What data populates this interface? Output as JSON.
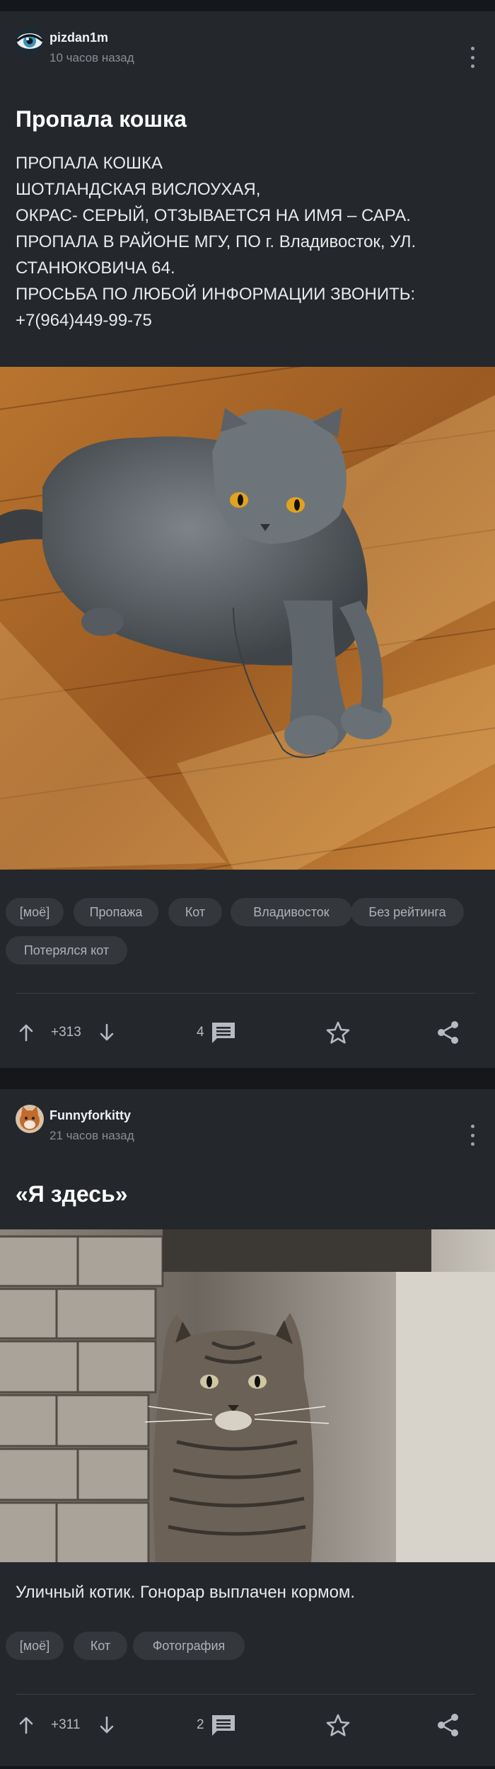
{
  "posts": [
    {
      "author": "pizdan1m",
      "time": "10 часов назад",
      "title": "Пропала кошка",
      "body": [
        "ПРОПАЛА КОШКА",
        "ШОТЛАНДСКАЯ ВИСЛОУХАЯ,",
        "ОКРАС- СЕРЫЙ, ОТЗЫВАЕТСЯ НА ИМЯ – САРА.",
        "ПРОПАЛА В РАЙОНЕ МГУ, ПО г. Владивосток, УЛ.",
        "СТАНЮКОВИЧА 64.",
        "ПРОСЬБА ПО ЛЮБОЙ ИНФОРМАЦИИ ЗВОНИТЬ:",
        "+7(964)449-99-75"
      ],
      "tags": [
        "[моё]",
        "Пропажа",
        "Кот",
        "Владивосток",
        "Без рейтинга",
        "Потерялся кот"
      ],
      "rating": "+313",
      "comments": "4"
    },
    {
      "author": "Funnyforkitty",
      "time": "21 часов назад",
      "title": "«Я здесь»",
      "caption": "Уличный котик. Гонорар выплачен кормом.",
      "tags": [
        "[моё]",
        "Кот",
        "Фотография"
      ],
      "rating": "+311",
      "comments": "2"
    }
  ],
  "icons": {
    "upvote": "arrow-up-icon",
    "downvote": "arrow-down-icon",
    "comments": "comment-icon",
    "save": "star-icon",
    "share": "share-icon",
    "menu": "kebab-menu-icon"
  },
  "colors": {
    "background": "#15171a",
    "card": "#24272b",
    "tag": "#34383d",
    "muted_text": "#8a8e94"
  }
}
